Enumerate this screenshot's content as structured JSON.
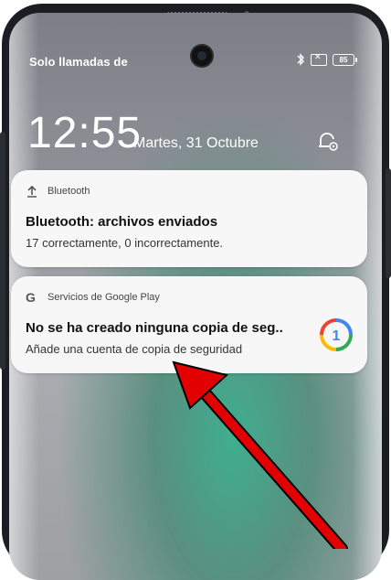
{
  "status_bar": {
    "left_text": "Solo llamadas de ",
    "battery": "85",
    "icons": [
      "bluetooth-icon",
      "no-sim-icon",
      "battery-icon"
    ]
  },
  "lockscreen": {
    "time": "12:55",
    "date": "Martes, 31 Octubre",
    "settings_icon": "ring-settings-icon"
  },
  "notifications": [
    {
      "app": "Bluetooth",
      "icon": "upload-icon",
      "title": "Bluetooth: archivos enviados",
      "body": "17 correctamente, 0 incorrectamente."
    },
    {
      "app": "Servicios de Google Play",
      "icon": "google-icon",
      "title": "No se ha creado ninguna copia de seg..",
      "body": "Añade una cuenta de copia de seguridad",
      "badge_icon": "google-one-icon",
      "badge_text": "1"
    }
  ],
  "annotation": {
    "color": "#e30000"
  }
}
